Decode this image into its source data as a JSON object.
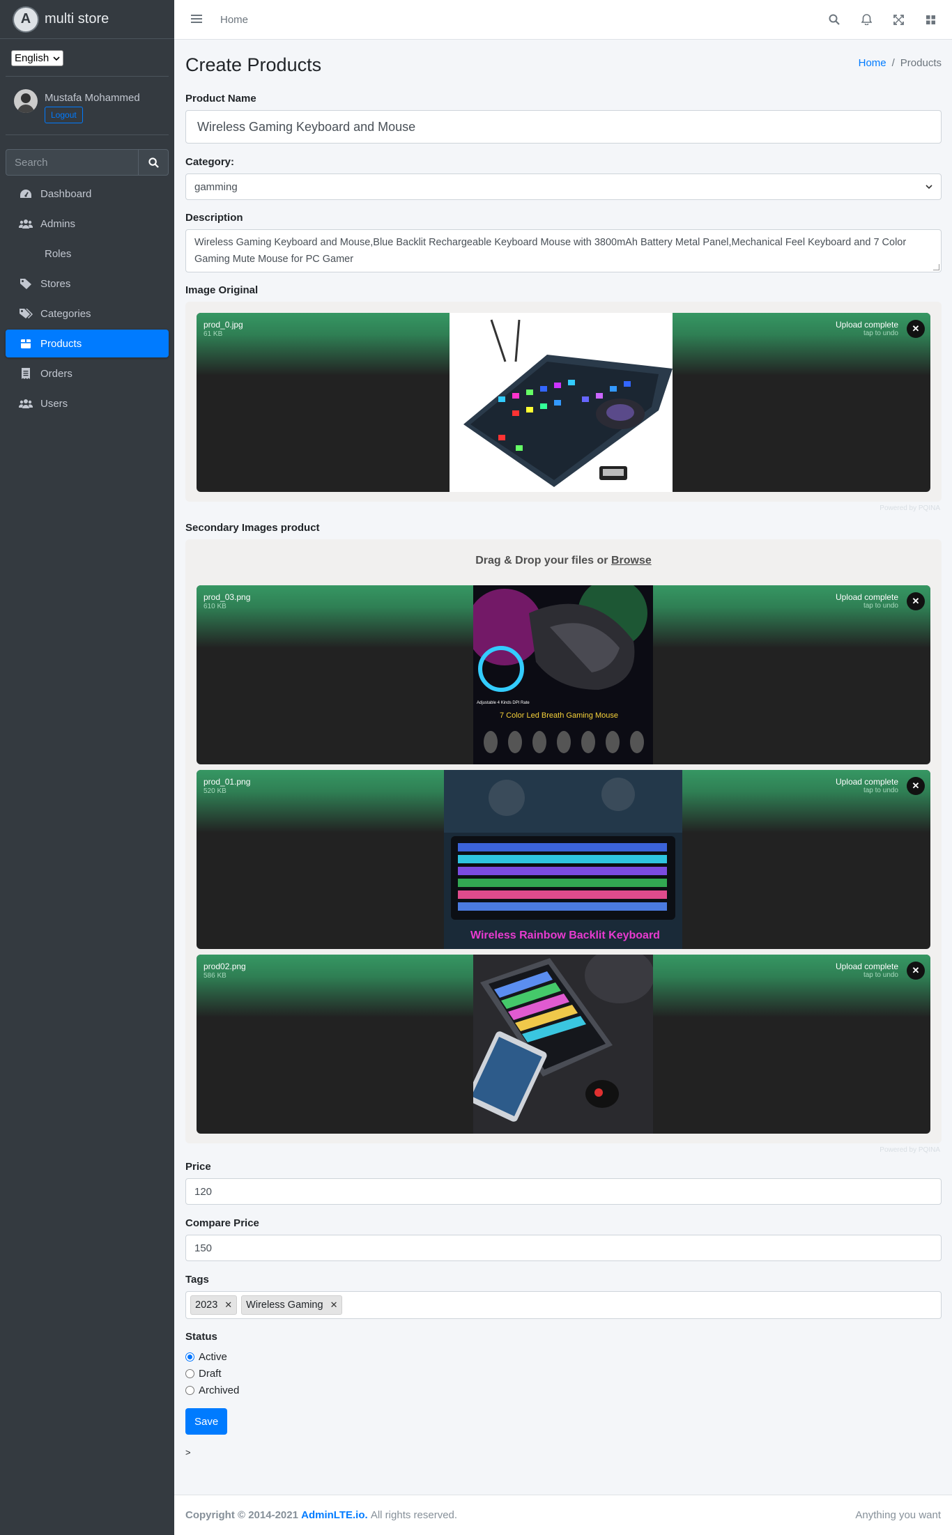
{
  "brand": {
    "name": "multi store"
  },
  "language": {
    "selected": "English"
  },
  "user": {
    "name": "Mustafa Mohammed",
    "logout_label": "Logout"
  },
  "sidebar_search": {
    "placeholder": "Search"
  },
  "nav": [
    {
      "label": "Dashboard",
      "icon": "dashboard-icon"
    },
    {
      "label": "Admins",
      "icon": "users-icon"
    },
    {
      "label": "Roles",
      "icon": ""
    },
    {
      "label": "Stores",
      "icon": "tag-icon"
    },
    {
      "label": "Categories",
      "icon": "tags-icon"
    },
    {
      "label": "Products",
      "icon": "box-icon",
      "active": true
    },
    {
      "label": "Orders",
      "icon": "receipt-icon"
    },
    {
      "label": "Users",
      "icon": "users-icon"
    }
  ],
  "topbar": {
    "home_label": "Home"
  },
  "page": {
    "title": "Create Products",
    "breadcrumb": {
      "home": "Home",
      "separator": "/",
      "current": "Products"
    }
  },
  "form": {
    "product_name": {
      "label": "Product Name",
      "value": "Wireless Gaming Keyboard and Mouse"
    },
    "category": {
      "label": "Category:",
      "value": "gamming"
    },
    "description": {
      "label": "Description",
      "value": "Wireless Gaming Keyboard and Mouse,Blue Backlit Rechargeable Keyboard Mouse with 3800mAh Battery Metal Panel,Mechanical Feel Keyboard and 7 Color Gaming Mute Mouse for PC Gamer"
    },
    "image_original": {
      "label": "Image Original",
      "file": {
        "name": "prod_0.jpg",
        "size": "61 KB",
        "status": "Upload complete",
        "undo": "tap to undo"
      },
      "credit": "Powered by PQINA"
    },
    "secondary_images": {
      "label": "Secondary Images product",
      "drop_text": "Drag & Drop your files or",
      "browse_label": "Browse",
      "files": [
        {
          "name": "prod_03.png",
          "size": "610 KB",
          "status": "Upload complete",
          "undo": "tap to undo",
          "caption": "7 Color Led Breath Gaming Mouse",
          "subcaption": "Adjustable 4 Kinds DPI Rate"
        },
        {
          "name": "prod_01.png",
          "size": "520 KB",
          "status": "Upload complete",
          "undo": "tap to undo",
          "caption": "Wireless Rainbow Backlit Keyboard"
        },
        {
          "name": "prod02.png",
          "size": "586 KB",
          "status": "Upload complete",
          "undo": "tap to undo"
        }
      ],
      "credit": "Powered by PQINA"
    },
    "price": {
      "label": "Price",
      "value": "120"
    },
    "compare_price": {
      "label": "Compare Price",
      "value": "150"
    },
    "tags": {
      "label": "Tags",
      "items": [
        "2023",
        "Wireless Gaming"
      ]
    },
    "status": {
      "label": "Status",
      "options": [
        "Active",
        "Draft",
        "Archived"
      ],
      "selected": "Active"
    },
    "save_label": "Save",
    "stray_text": ">"
  },
  "footer": {
    "copyright_prefix": "Copyright © 2014-2021",
    "link": "AdminLTE.io.",
    "rights": "All rights reserved.",
    "right_text": "Anything you want"
  },
  "colors": {
    "primary": "#007bff",
    "sidebar_bg": "#343a40",
    "upload_green": "#369763"
  }
}
